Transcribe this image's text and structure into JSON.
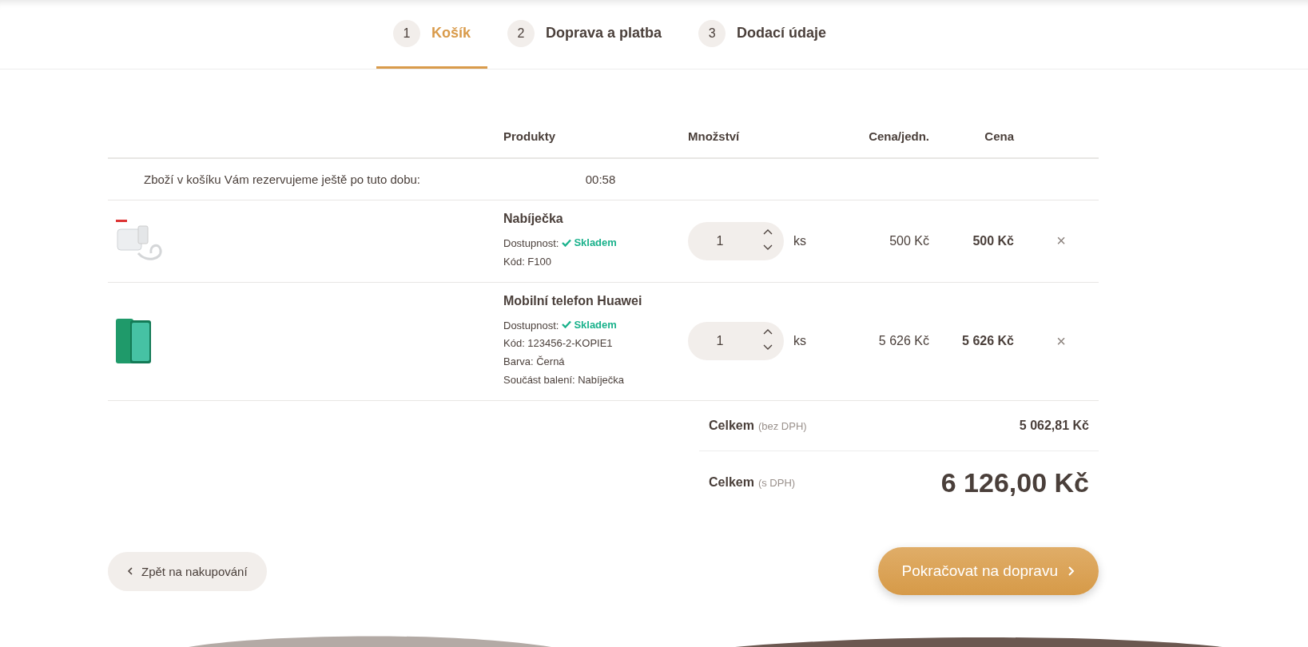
{
  "steps": [
    {
      "number": "1",
      "label": "Košík",
      "selected": true
    },
    {
      "number": "2",
      "label": "Doprava a platba",
      "selected": false
    },
    {
      "number": "3",
      "label": "Dodací údaje",
      "selected": false
    }
  ],
  "table": {
    "columns": [
      "Produkty",
      "Množství",
      "Cena/jedn.",
      "Cena"
    ],
    "reservation": {
      "text": "Zboží v košíku Vám rezervujeme ještě po tuto dobu:",
      "time": "00:58"
    },
    "rows": [
      {
        "kind": "charger",
        "name": "Nabíječka",
        "availability": {
          "label": "Dostupnost:",
          "value": "Skladem",
          "in_stock": true
        },
        "details": [
          "Kód: F100"
        ],
        "quantity": "1",
        "unit": "ks",
        "unit_price": "500 Kč",
        "price": "500 Kč",
        "remove": "×"
      },
      {
        "kind": "phone",
        "name": "Mobilní telefon Huawei",
        "availability": {
          "label": "Dostupnost:",
          "value": "Skladem",
          "in_stock": true
        },
        "details": [
          "Kód: 123456-2-KOPIE1",
          "Barva: Černá",
          "Součást balení: Nabíječka"
        ],
        "quantity": "1",
        "unit": "ks",
        "unit_price": "5 626 Kč",
        "price": "5 626 Kč",
        "remove": "×"
      }
    ]
  },
  "summary": [
    {
      "kind": "subtotal",
      "label": "Celkem",
      "note": "(bez DPH)",
      "value": "5 062,81 Kč"
    },
    {
      "kind": "total",
      "label": "Celkem",
      "note": "(s DPH)",
      "value": "6 126,00 Kč"
    }
  ],
  "back_button": "Zpět na nakupování",
  "continue_button": "Pokračovat na dopravu"
}
